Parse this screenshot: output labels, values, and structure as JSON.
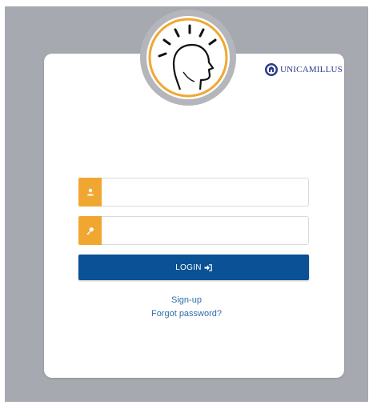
{
  "brand": {
    "name": "UNICAMILLUS"
  },
  "form": {
    "username": {
      "icon": "user-icon",
      "value": "",
      "placeholder": ""
    },
    "password": {
      "icon": "key-icon",
      "value": "",
      "placeholder": ""
    },
    "login_label": "LOGIN",
    "login_icon": "sign-in-icon"
  },
  "links": {
    "signup": "Sign-up",
    "forgot_password": "Forgot password?"
  },
  "colors": {
    "accent": "#f0a731",
    "primary": "#0b5195",
    "link": "#2f6ea8",
    "backdrop": "#a7a9b0"
  }
}
